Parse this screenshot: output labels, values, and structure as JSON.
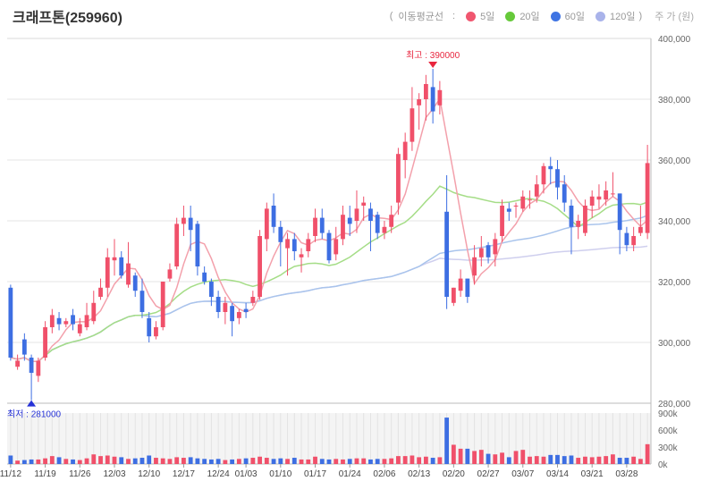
{
  "title": "크래프톤(259960)",
  "legend": {
    "open": "(",
    "label": "이동평균선",
    "colon": ":",
    "close": ")",
    "items": [
      {
        "name": "5일",
        "color": "#f0566f"
      },
      {
        "name": "20일",
        "color": "#66c93a"
      },
      {
        "name": "60일",
        "color": "#3f74e3"
      },
      {
        "name": "120일",
        "color": "#a9b3ea"
      }
    ],
    "unit": "주 가 (원)"
  },
  "colors": {
    "up": "#f0506a",
    "down": "#3d6ee2",
    "ma5": "#f3a0ab",
    "ma20": "#a5dd87",
    "ma60": "#a9c4ec",
    "ma120": "#cfcfee",
    "high_marker": "#e8253e",
    "low_marker": "#2531d6"
  },
  "chart_data": {
    "type": "candlestick",
    "price_axis": {
      "min": 280000,
      "max": 400000,
      "ticks": [
        280000,
        300000,
        320000,
        340000,
        360000,
        380000,
        400000
      ],
      "tick_labels": [
        "280,000",
        "300,000",
        "320,000",
        "340,000",
        "360,000",
        "380,000",
        "400,000"
      ]
    },
    "volume_axis": {
      "min": 0,
      "max": 900000,
      "ticks": [
        0,
        300000,
        600000,
        900000
      ],
      "tick_labels": [
        "0k",
        "300k",
        "600k",
        "900k"
      ]
    },
    "x_tick_labels": [
      {
        "index": 0,
        "label": "11/12"
      },
      {
        "index": 5,
        "label": "11/19"
      },
      {
        "index": 10,
        "label": "11/26"
      },
      {
        "index": 15,
        "label": "12/03"
      },
      {
        "index": 20,
        "label": "12/10"
      },
      {
        "index": 25,
        "label": "12/17"
      },
      {
        "index": 30,
        "label": "12/24"
      },
      {
        "index": 34,
        "label": "01/03"
      },
      {
        "index": 39,
        "label": "01/10"
      },
      {
        "index": 44,
        "label": "01/17"
      },
      {
        "index": 49,
        "label": "01/24"
      },
      {
        "index": 54,
        "label": "02/06"
      },
      {
        "index": 59,
        "label": "02/13"
      },
      {
        "index": 64,
        "label": "02/20"
      },
      {
        "index": 69,
        "label": "02/27"
      },
      {
        "index": 74,
        "label": "03/07"
      },
      {
        "index": 79,
        "label": "03/14"
      },
      {
        "index": 84,
        "label": "03/21"
      },
      {
        "index": 89,
        "label": "03/28"
      }
    ],
    "candles": [
      [
        318000,
        295000,
        319000,
        294000
      ],
      [
        292000,
        294000,
        296000,
        291000
      ],
      [
        301000,
        296000,
        303000,
        294000
      ],
      [
        295000,
        290000,
        296000,
        281000
      ],
      [
        289000,
        294000,
        295000,
        287000
      ],
      [
        295000,
        305000,
        307000,
        294000
      ],
      [
        305000,
        309000,
        311000,
        303000
      ],
      [
        308000,
        306000,
        310000,
        304000
      ],
      [
        306000,
        307000,
        308000,
        305000
      ],
      [
        309000,
        306000,
        311000,
        304000
      ],
      [
        303000,
        306000,
        308000,
        302000
      ],
      [
        305000,
        309000,
        313000,
        304000
      ],
      [
        307000,
        313000,
        317000,
        306000
      ],
      [
        315000,
        318000,
        321000,
        314000
      ],
      [
        318000,
        328000,
        331000,
        315000
      ],
      [
        327000,
        328000,
        334000,
        322000
      ],
      [
        328000,
        322000,
        330000,
        321000
      ],
      [
        319000,
        326000,
        333000,
        318000
      ],
      [
        322000,
        317000,
        323000,
        315000
      ],
      [
        317000,
        310000,
        321000,
        308000
      ],
      [
        308000,
        302000,
        310000,
        300000
      ],
      [
        302000,
        305000,
        307000,
        301000
      ],
      [
        305000,
        320000,
        320000,
        304000
      ],
      [
        321000,
        324000,
        326000,
        320000
      ],
      [
        325000,
        339000,
        341000,
        324000
      ],
      [
        339000,
        341000,
        345000,
        335000
      ],
      [
        341000,
        337000,
        345000,
        330000
      ],
      [
        339000,
        325000,
        340000,
        322000
      ],
      [
        323000,
        320000,
        325000,
        319000
      ],
      [
        320000,
        315000,
        321000,
        312000
      ],
      [
        315000,
        310000,
        317000,
        308000
      ],
      [
        310000,
        313000,
        315000,
        306000
      ],
      [
        312000,
        307000,
        313000,
        302000
      ],
      [
        308000,
        310000,
        311000,
        306000
      ],
      [
        311000,
        310000,
        313000,
        308000
      ],
      [
        313000,
        315000,
        317000,
        312000
      ],
      [
        315000,
        335000,
        337000,
        314000
      ],
      [
        334000,
        344000,
        346000,
        330000
      ],
      [
        345000,
        338000,
        349000,
        336000
      ],
      [
        338000,
        333000,
        340000,
        325000
      ],
      [
        331000,
        334000,
        336000,
        322000
      ],
      [
        334000,
        330000,
        336000,
        327000
      ],
      [
        328000,
        329000,
        331000,
        323000
      ],
      [
        330000,
        334000,
        336000,
        328000
      ],
      [
        335000,
        341000,
        344000,
        333000
      ],
      [
        341000,
        336000,
        344000,
        334000
      ],
      [
        336000,
        327000,
        337000,
        326000
      ],
      [
        329000,
        334000,
        338000,
        327000
      ],
      [
        334000,
        342000,
        345000,
        332000
      ],
      [
        341000,
        339000,
        345000,
        335000
      ],
      [
        340000,
        344000,
        350000,
        336000
      ],
      [
        345000,
        346000,
        348000,
        340000
      ],
      [
        344000,
        340000,
        346000,
        330000
      ],
      [
        342000,
        336000,
        343000,
        334000
      ],
      [
        336000,
        338000,
        340000,
        334000
      ],
      [
        338000,
        342000,
        345000,
        336000
      ],
      [
        346000,
        362000,
        364000,
        342000
      ],
      [
        360000,
        366000,
        369000,
        354000
      ],
      [
        366000,
        377000,
        384000,
        363000
      ],
      [
        378000,
        380000,
        382000,
        370000
      ],
      [
        380000,
        385000,
        388000,
        373000
      ],
      [
        384000,
        376000,
        390000,
        372000
      ],
      [
        378000,
        383000,
        386000,
        375000
      ],
      [
        343000,
        315000,
        355000,
        311000
      ],
      [
        313000,
        318000,
        318000,
        312000
      ],
      [
        317000,
        321000,
        324000,
        315000
      ],
      [
        321000,
        315000,
        321000,
        313000
      ],
      [
        322000,
        328000,
        332000,
        319000
      ],
      [
        328000,
        331000,
        335000,
        325000
      ],
      [
        332000,
        328000,
        333000,
        326000
      ],
      [
        329000,
        334000,
        336000,
        325000
      ],
      [
        335000,
        345000,
        347000,
        333000
      ],
      [
        344000,
        343000,
        346000,
        340000
      ],
      [
        345000,
        345000,
        346000,
        341000
      ],
      [
        344000,
        348000,
        350000,
        343000
      ],
      [
        347000,
        347000,
        350000,
        344000
      ],
      [
        348000,
        352000,
        355000,
        346000
      ],
      [
        352000,
        358000,
        359000,
        349000
      ],
      [
        358000,
        357000,
        361000,
        352000
      ],
      [
        357000,
        351000,
        360000,
        347000
      ],
      [
        352000,
        346000,
        355000,
        343000
      ],
      [
        345000,
        338000,
        347000,
        329000
      ],
      [
        338000,
        340000,
        342000,
        334000
      ],
      [
        336000,
        345000,
        347000,
        335000
      ],
      [
        345000,
        348000,
        350000,
        341000
      ],
      [
        347000,
        348000,
        352000,
        344000
      ],
      [
        347000,
        350000,
        353000,
        345000
      ],
      [
        349000,
        349000,
        356000,
        348000
      ],
      [
        349000,
        337000,
        349000,
        329000
      ],
      [
        336000,
        332000,
        338000,
        330000
      ],
      [
        332000,
        335000,
        338000,
        330000
      ],
      [
        336000,
        338000,
        345000,
        335000
      ],
      [
        336000,
        359000,
        365000,
        334000
      ]
    ],
    "volumes": [
      150000,
      60000,
      70000,
      80000,
      80000,
      100000,
      140000,
      120000,
      90000,
      80000,
      70000,
      100000,
      170000,
      140000,
      150000,
      130000,
      120000,
      90000,
      100000,
      110000,
      150000,
      110000,
      100000,
      90000,
      120000,
      110000,
      120000,
      100000,
      90000,
      80000,
      90000,
      70000,
      80000,
      90000,
      100000,
      110000,
      130000,
      110000,
      90000,
      100000,
      90000,
      110000,
      80000,
      80000,
      130000,
      90000,
      80000,
      90000,
      80000,
      90000,
      100000,
      100000,
      80000,
      90000,
      90000,
      100000,
      140000,
      140000,
      150000,
      120000,
      130000,
      110000,
      120000,
      820000,
      340000,
      270000,
      270000,
      230000,
      250000,
      180000,
      170000,
      200000,
      120000,
      230000,
      250000,
      130000,
      140000,
      130000,
      160000,
      160000,
      140000,
      150000,
      110000,
      130000,
      120000,
      130000,
      140000,
      170000,
      110000,
      110000,
      130000,
      90000,
      350000
    ],
    "high": {
      "label": "최고 : 390000",
      "value": 390000,
      "index": 61
    },
    "low": {
      "label": "최저 : 281000",
      "value": 281000,
      "index": 3
    }
  }
}
